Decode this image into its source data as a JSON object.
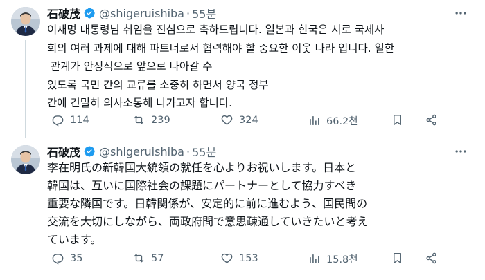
{
  "tweets": [
    {
      "author": {
        "name": "石破茂",
        "handle": "@shigeruishiba",
        "time": "55분"
      },
      "lines": [
        "이재명 대통령님 취임을 진심으로 축하드립니다. 일본과 한국은 서로 국제사",
        "회의 여러 과제에 대해 파트너로서 협력해야 할 중요한 이웃 나라 입니다. 일한",
        " 관계가 안정적으로 앞으로 나아갈 수",
        "있도록 국민 간의 교류를 소중히 하면서 양국 정부",
        "간에 긴밀히 의사소통해 나가고자 합니다."
      ],
      "stats": {
        "replies": "114",
        "retweets": "239",
        "likes": "324",
        "views": "66.2천"
      }
    },
    {
      "author": {
        "name": "石破茂",
        "handle": "@shigeruishiba",
        "time": "55분"
      },
      "lines": [
        "李在明氏の新韓国大統領の就任を心よりお祝いします。日本と",
        "韓国は、互いに国際社会の課題にパートナーとして協力すべき",
        "重要な隣国です。日韓関係が、安定的に前に進むよう、国民間の",
        "交流を大切にしながら、両政府間で意思疎通していきたいと考え",
        "ています。"
      ],
      "stats": {
        "replies": "35",
        "retweets": "57",
        "likes": "153",
        "views": "15.8천"
      }
    }
  ],
  "colors": {
    "text": "#0f1419",
    "muted": "#536471",
    "verified": "#1d9bf0",
    "divider": "#eff3f4"
  },
  "icons": [
    "reply-icon",
    "retweet-icon",
    "like-icon",
    "views-icon",
    "bookmark-icon",
    "share-icon",
    "more-icon",
    "verified-badge-icon"
  ]
}
